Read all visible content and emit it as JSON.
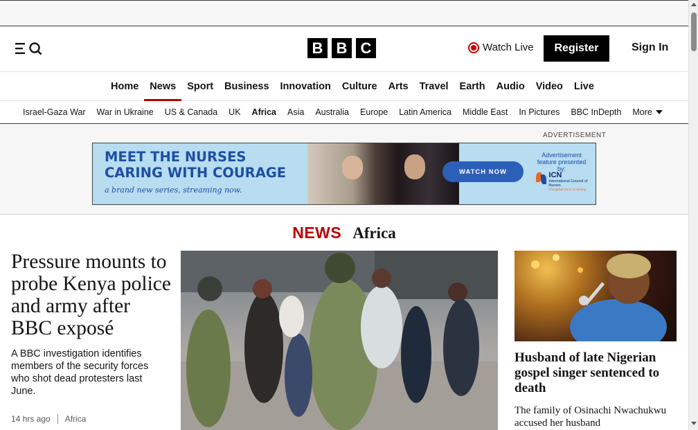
{
  "header": {
    "menu_icon": "menu-search-icon",
    "logo_letters": [
      "B",
      "B",
      "C"
    ],
    "watch_live_label": "Watch Live",
    "register_label": "Register",
    "signin_label": "Sign In"
  },
  "main_nav": {
    "items": [
      {
        "label": "Home",
        "active": false
      },
      {
        "label": "News",
        "active": true
      },
      {
        "label": "Sport",
        "active": false
      },
      {
        "label": "Business",
        "active": false
      },
      {
        "label": "Innovation",
        "active": false
      },
      {
        "label": "Culture",
        "active": false
      },
      {
        "label": "Arts",
        "active": false
      },
      {
        "label": "Travel",
        "active": false
      },
      {
        "label": "Earth",
        "active": false
      },
      {
        "label": "Audio",
        "active": false
      },
      {
        "label": "Video",
        "active": false
      },
      {
        "label": "Live",
        "active": false
      }
    ]
  },
  "sub_nav": {
    "items": [
      {
        "label": "Israel-Gaza War",
        "active": false
      },
      {
        "label": "War in Ukraine",
        "active": false
      },
      {
        "label": "US & Canada",
        "active": false
      },
      {
        "label": "UK",
        "active": false
      },
      {
        "label": "Africa",
        "active": true
      },
      {
        "label": "Asia",
        "active": false
      },
      {
        "label": "Australia",
        "active": false
      },
      {
        "label": "Europe",
        "active": false
      },
      {
        "label": "Latin America",
        "active": false
      },
      {
        "label": "Middle East",
        "active": false
      },
      {
        "label": "In Pictures",
        "active": false
      },
      {
        "label": "BBC InDepth",
        "active": false
      }
    ],
    "more_label": "More"
  },
  "ad": {
    "label": "ADVERTISEMENT",
    "headline_line1": "MEET THE NURSES",
    "headline_line2": "CARING WITH COURAGE",
    "tagline": "a brand new series, streaming now.",
    "cta": "WATCH NOW",
    "sponsor_line1": "Advertisement",
    "sponsor_line2": "feature presented by:",
    "sponsor_name": "ICN",
    "sponsor_full": "International Council of Nurses",
    "sponsor_slogan": "The global voice of nursing"
  },
  "section": {
    "brand": "NEWS",
    "region": "Africa"
  },
  "lead_story": {
    "title": "Pressure mounts to probe Kenya police and army after BBC exposé",
    "summary": "A BBC investigation identifies members of the security forces who shot dead protesters last June.",
    "time": "14 hrs ago",
    "category": "Africa"
  },
  "side_story": {
    "title": "Husband of late Nigerian gospel singer sentenced to death",
    "summary": "The family of Osinachi Nwachukwu accused her husband"
  },
  "colors": {
    "accent": "#b80000",
    "ad_blue": "#1e4fa3",
    "ad_bg": "#b8dcf0"
  }
}
